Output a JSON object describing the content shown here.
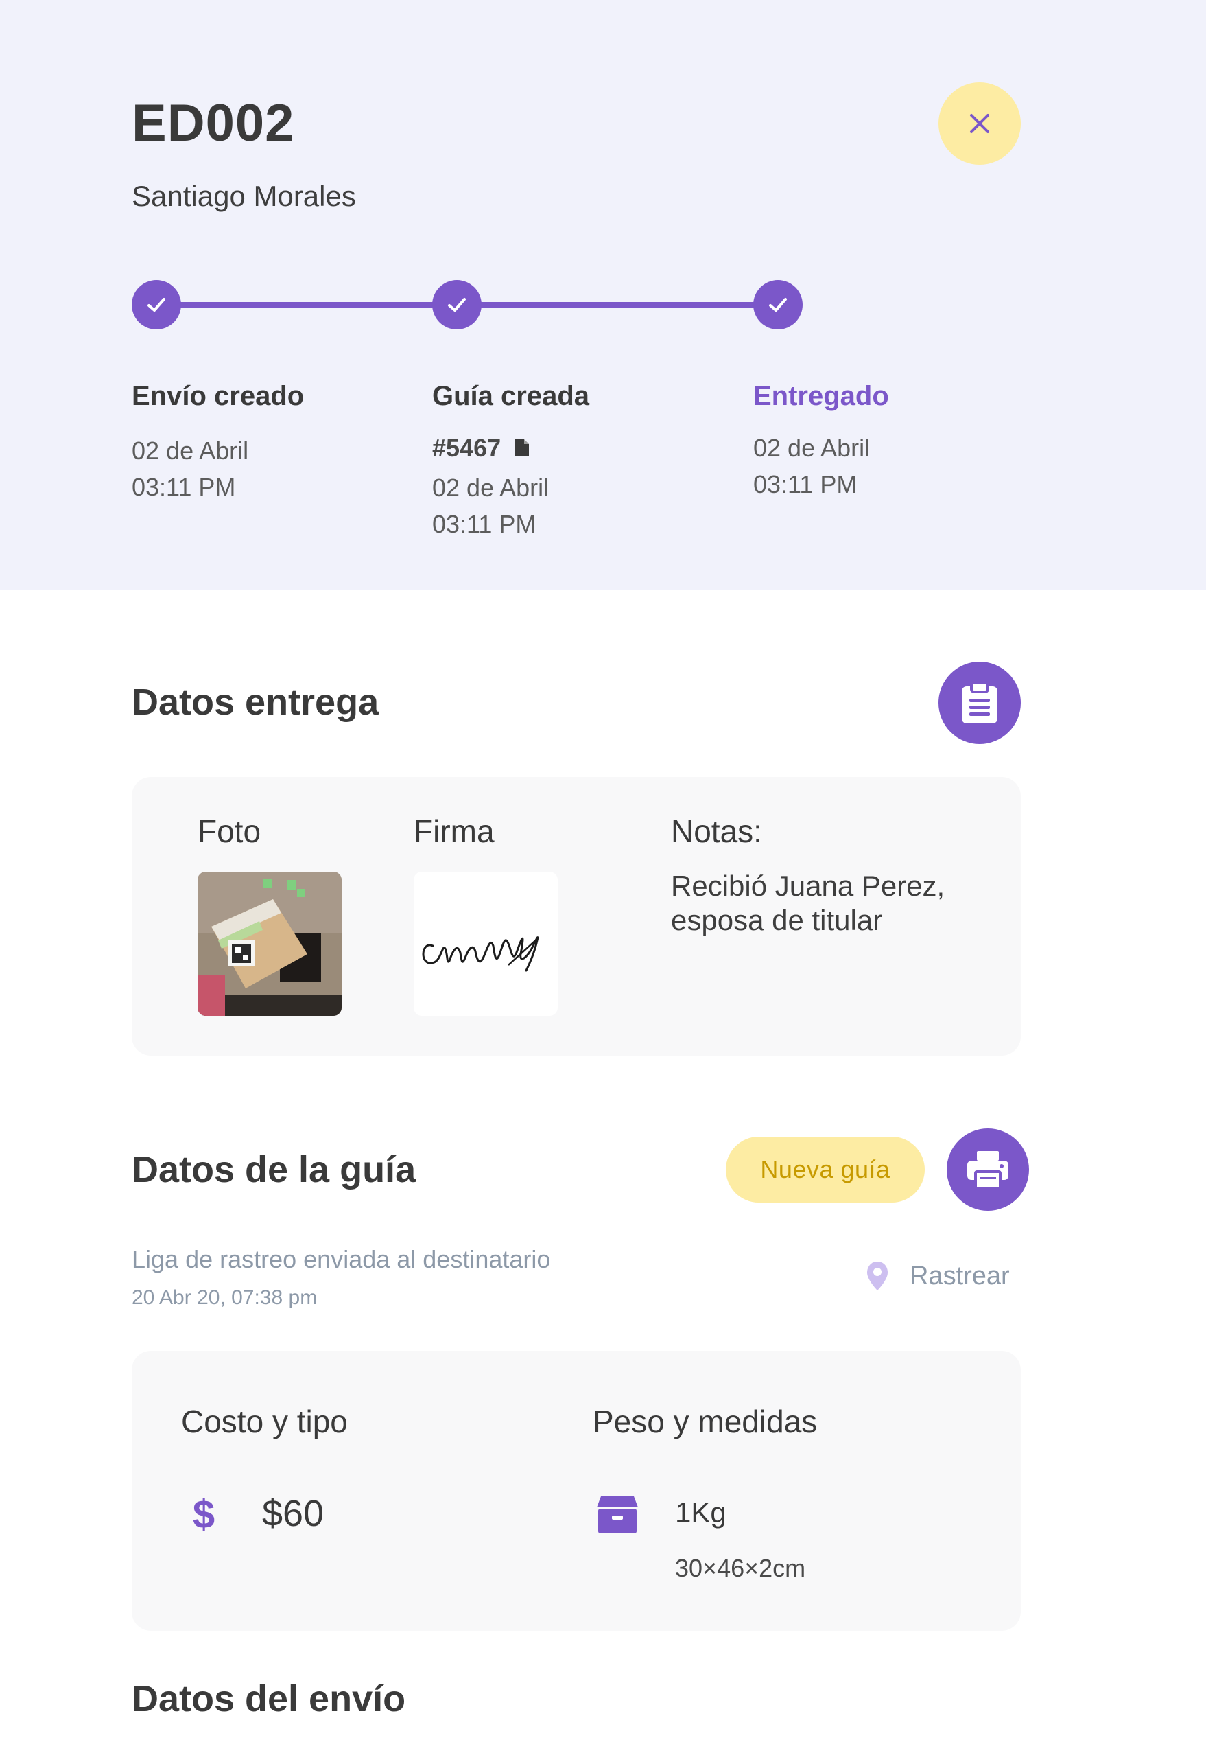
{
  "header": {
    "id": "ED002",
    "customer": "Santiago Morales",
    "steps": [
      {
        "title": "Envío creado",
        "date": "02 de Abril",
        "time": "03:11 PM"
      },
      {
        "title": "Guía creada",
        "guide_number": "#5467",
        "date": "02 de Abril",
        "time": "03:11 PM"
      },
      {
        "title": "Entregado",
        "date": "02 de Abril",
        "time": "03:11 PM"
      }
    ]
  },
  "delivery": {
    "title": "Datos entrega",
    "photo_label": "Foto",
    "signature_label": "Firma",
    "notes_label": "Notas:",
    "notes": "Recibió Juana Perez, esposa de titular"
  },
  "guide": {
    "title": "Datos de la guía",
    "new_guide_label": "Nueva guía",
    "tracking_sent": "Liga de rastreo enviada al destinatario",
    "tracking_date": "20 Abr 20, 07:38 pm",
    "track_label": "Rastrear",
    "cost_label": "Costo y tipo",
    "cost_value": "$60",
    "weight_label": "Peso y medidas",
    "weight_value": "1Kg",
    "dimensions": "30×46×2cm"
  },
  "shipment": {
    "title": "Datos del envío"
  },
  "colors": {
    "primary": "#7b57c9",
    "header_bg": "#f1f2fb",
    "yellow": "#fdeca3",
    "yellow_text": "#c79a00",
    "muted": "#8d99a8"
  },
  "icons": {
    "close": "close-icon",
    "check": "check-icon",
    "copy": "copy-icon",
    "clipboard": "clipboard-icon",
    "printer": "printer-icon",
    "location": "location-pin-icon",
    "dollar": "dollar-icon",
    "box": "box-icon"
  }
}
